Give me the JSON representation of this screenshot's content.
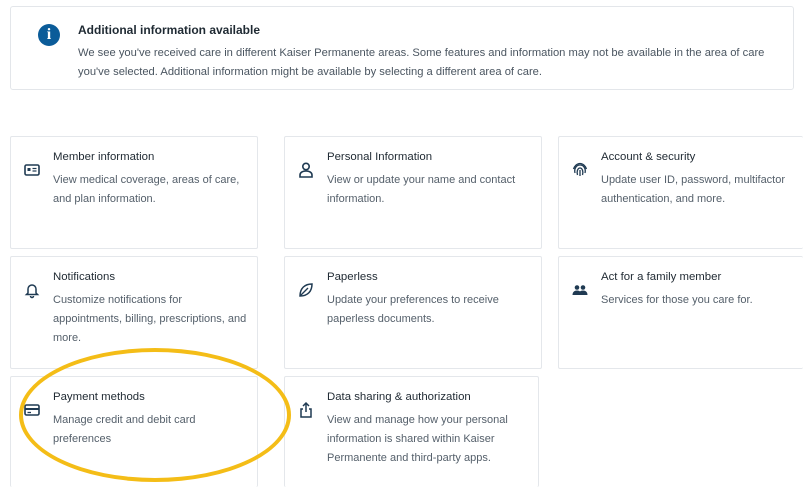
{
  "banner": {
    "icon": "info-icon",
    "icon_glyph": "i",
    "title": "Additional information available",
    "text": "We see you've received care in different Kaiser Permanente areas. Some features and information may not be available in the area of care you've selected. Additional information might be available by selecting a different area of care."
  },
  "cards": [
    {
      "title": "Member information",
      "description": "View medical coverage, areas of care, and plan information.",
      "icon": "member-card-icon"
    },
    {
      "title": "Personal Information",
      "description": "View or update your name and contact information.",
      "icon": "person-icon"
    },
    {
      "title": "Account & security",
      "description": "Update user ID, password, multifactor authentication, and more.",
      "icon": "fingerprint-icon"
    },
    {
      "title": "Notifications",
      "description": "Customize notifications for appointments, billing, prescriptions, and more.",
      "icon": "bell-icon"
    },
    {
      "title": "Paperless",
      "description": "Update your preferences to receive paperless documents.",
      "icon": "leaf-icon"
    },
    {
      "title": "Act for a family member",
      "description": "Services for those you care for.",
      "icon": "family-icon"
    },
    {
      "title": "Payment methods",
      "description": "Manage credit and debit card preferences",
      "icon": "credit-card-icon"
    },
    {
      "title": "Data sharing & authorization",
      "description": "View and manage how your personal information is shared within Kaiser Permanente and third-party apps.",
      "icon": "share-icon"
    }
  ],
  "colors": {
    "accent": "#0b5c99",
    "highlight": "#f4bd17",
    "icon": "#1f3a52"
  }
}
